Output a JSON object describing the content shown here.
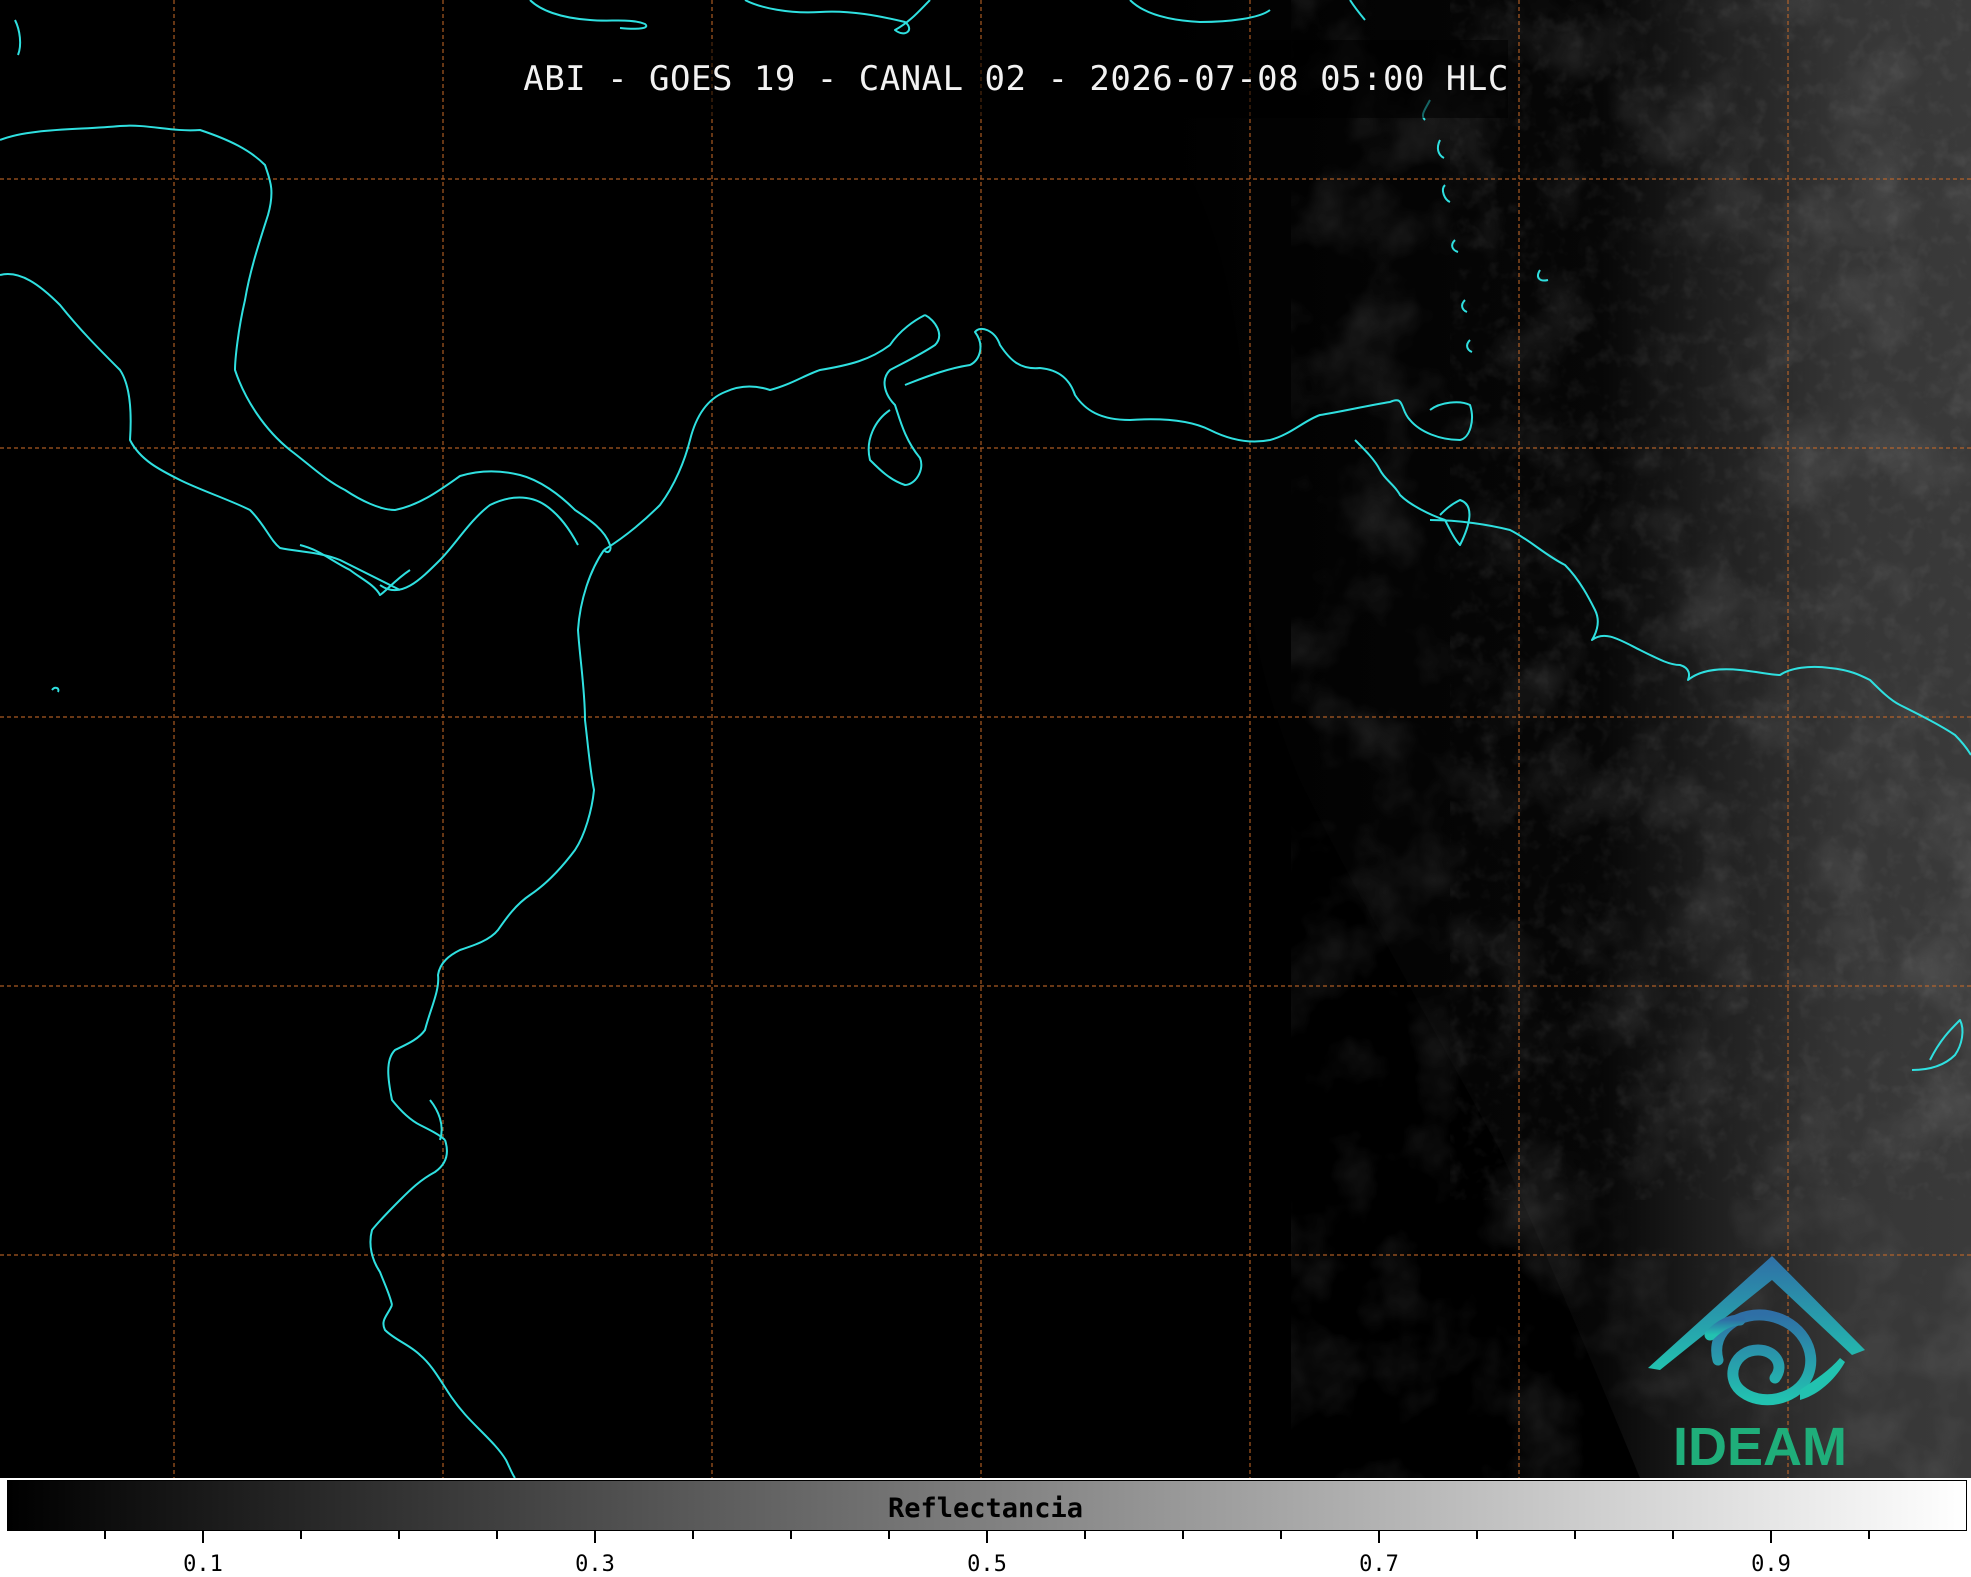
{
  "title": "ABI - GOES 19 - CANAL 02 - 2026-07-08 05:00 HLC",
  "colorbar": {
    "label": "Reflectancia",
    "min": 0.0,
    "max": 1.0,
    "ticks": [
      "0.1",
      "0.3",
      "0.5",
      "0.7",
      "0.9"
    ],
    "tick_values": [
      0.1,
      0.3,
      0.5,
      0.7,
      0.9
    ],
    "minor_step": 0.05
  },
  "logo": {
    "text": "IDEAM",
    "colors": [
      "#2f6fa6",
      "#1fae7a",
      "#22c2b0"
    ]
  },
  "colors": {
    "coastline": "#2fe0e0",
    "gridlines": "#c86a28",
    "background": "#000000"
  }
}
